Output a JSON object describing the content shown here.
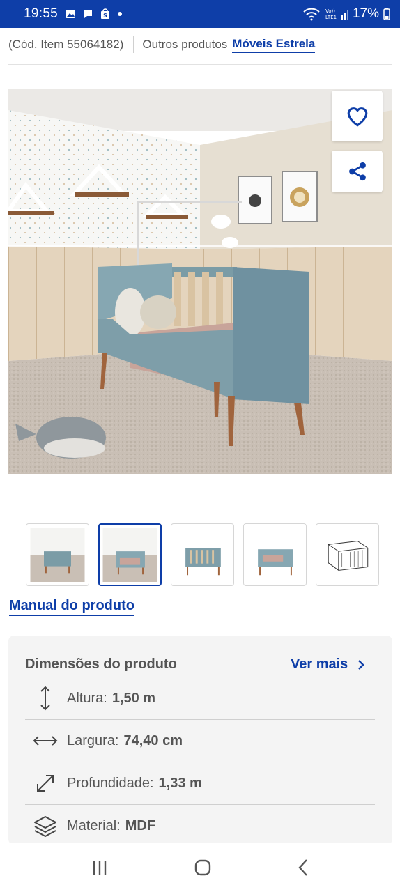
{
  "status": {
    "time": "19:55",
    "battery": "17%"
  },
  "header": {
    "item_code": "(Cód. Item 55064182)",
    "other_products": "Outros produtos",
    "brand": "Móveis Estrela"
  },
  "gallery": {
    "thumbnail_count": 5,
    "active_index": 1
  },
  "manual_link": "Manual do produto",
  "dimensions": {
    "title": "Dimensões do produto",
    "see_more": "Ver mais",
    "rows": [
      {
        "icon": "height-arrow-icon",
        "label": "Altura:",
        "value": "1,50 m"
      },
      {
        "icon": "width-arrow-icon",
        "label": "Largura:",
        "value": "74,40 cm"
      },
      {
        "icon": "diagonal-arrow-icon",
        "label": "Profundidade:",
        "value": "1,33 m"
      },
      {
        "icon": "layers-icon",
        "label": "Material:",
        "value": "MDF"
      }
    ]
  },
  "colors": {
    "brand_blue": "#0e3ea8",
    "card_bg": "#f4f4f4"
  }
}
